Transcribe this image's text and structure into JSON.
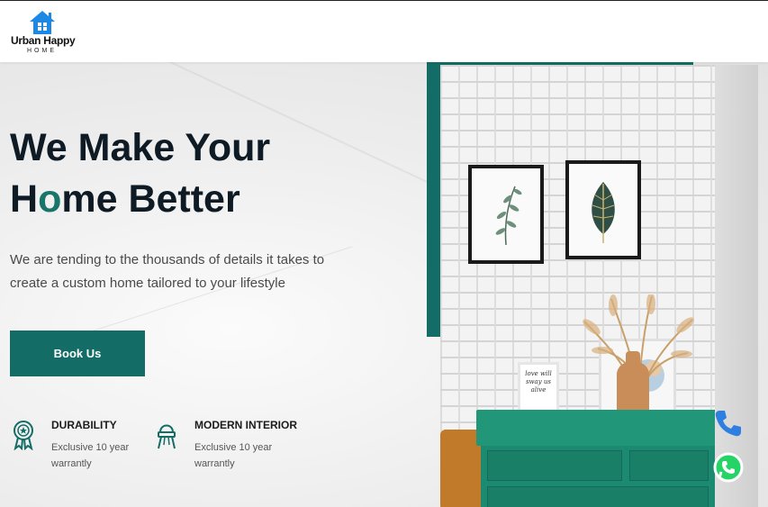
{
  "brand": {
    "name": "Urban Happy",
    "sub": "HOME",
    "colors": {
      "primary": "#136d66",
      "accent_letter": "#17756a",
      "logo_blue": "#1e88e5",
      "dark": "#0e1a24"
    }
  },
  "hero": {
    "headline_line1": "We Make Your",
    "headline_line2_pre": "H",
    "headline_line2_accent": "o",
    "headline_line2_post": "me Better",
    "subtext": "We are tending to the thousands of details it takes to create a custom home tailored to your lifestyle",
    "cta_label": "Book Us"
  },
  "features": [
    {
      "icon": "award-ribbon-icon",
      "title": "DURABILITY",
      "desc": "Exclusive 10 year warrantly"
    },
    {
      "icon": "chair-icon",
      "title": "MODERN INTERIOR",
      "desc": "Exclusive 10 year warrantly"
    }
  ],
  "art": {
    "small_frame_text": "love will sway us alive"
  },
  "floating": {
    "phone_icon": "phone-icon",
    "whatsapp_icon": "whatsapp-icon"
  }
}
